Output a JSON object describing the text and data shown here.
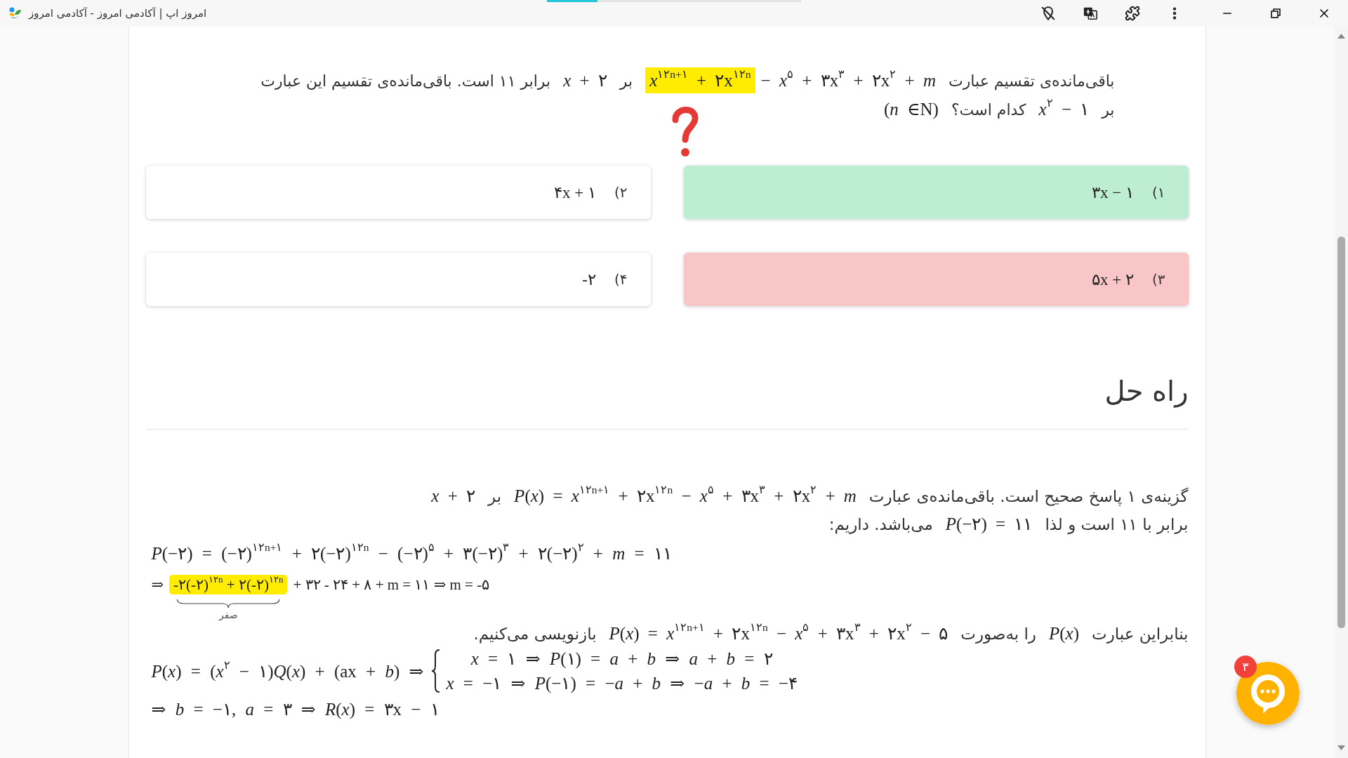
{
  "window": {
    "title": "امروز اپ | آکادمی امروز - آکادمی امروز",
    "loading_bar": {
      "level": 0.2
    }
  },
  "question": {
    "lines": [
      [
        {
          "kind": "text",
          "text": "باقی‌مانده‌ی تقسیم عبارت"
        },
        {
          "kind": "math",
          "highlighted_text": "*x*$^{۱۲n+۱}$ + ۲x$^{۱۲n}$",
          "text": "− *x*$^{۵}$ + ۳x$^{۳}$ + ۲x$^{۲}$ + *m*"
        },
        {
          "kind": "text",
          "text": "بر"
        },
        {
          "kind": "math",
          "text": "*x* + ۲"
        },
        {
          "kind": "text",
          "text": "برابر ۱۱ است. باقی‌مانده‌ی تقسیم این عبارت"
        }
      ],
      [
        {
          "kind": "text",
          "text": "بر"
        },
        {
          "kind": "math",
          "text": "*x*$^{۲}$ − ۱"
        },
        {
          "kind": "text",
          "text": "کدام است؟"
        },
        {
          "kind": "math",
          "text": "(*n* ∈N)"
        }
      ]
    ],
    "options": [
      {
        "number": "۱)",
        "value": "۳x − ۱",
        "correct": true,
        "selected": false
      },
      {
        "number": "۲)",
        "value": "۴x + ۱",
        "correct": false,
        "selected": false
      },
      {
        "number": "۳)",
        "value": "۵x + ۲",
        "correct": false,
        "selected": true
      },
      {
        "number": "۴)",
        "value": "-۲",
        "correct": false,
        "selected": false
      }
    ]
  },
  "solution": {
    "heading": "راه حل",
    "blocks": [
      {
        "kind": "paragraph",
        "lines": [
          [
            {
              "kind": "text",
              "text": "گزینه‌ی ۱ پاسخ صحیح است. باقی‌مانده‌ی عبارت"
            },
            {
              "kind": "math",
              "text": "*P*(*x*) = *x*$^{۱۲n+۱}$ + ۲x$^{۱۲n}$ − *x*$^{۵}$ + ۳x$^{۳}$ + ۲x$^{۲}$ + *m*"
            },
            {
              "kind": "text",
              "text": "بر"
            },
            {
              "kind": "math",
              "text": "*x* + ۲"
            }
          ],
          [
            {
              "kind": "text",
              "text": "برابر با ۱۱ است و لذا"
            },
            {
              "kind": "math",
              "text": "*P*(−۲) = ۱۱"
            },
            {
              "kind": "text",
              "text": "می‌باشد. داریم:"
            }
          ]
        ]
      },
      {
        "kind": "equation",
        "text": "*P*(−۲) = (−۲)$^{۱۲n+۱}$ + ۲(−۲)$^{۱۲n}$ − (−۲)$^{۵}$ + ۳(−۲)$^{۳}$ + ۲(−۲)$^{۲}$ + *m* = ۱۱"
      },
      {
        "kind": "equation",
        "lead": "⇒",
        "highlighted_text": "-۲(-۲)$^{۱۲n}$ + ۲(-۲)$^{۱۲n}$",
        "note": "صفر",
        "text": "+ ۳۲ - ۲۴ + ۸ + m = ۱۱ ⇒ m = -۵"
      },
      {
        "kind": "paragraph",
        "lines": [
          [
            {
              "kind": "text",
              "text": "بنابراین عبارت"
            },
            {
              "kind": "math",
              "text": "*P*(*x*)"
            },
            {
              "kind": "text",
              "text": "را به‌صورت"
            },
            {
              "kind": "math",
              "text": "*P*(*x*) = *x*$^{۱۲n+۱}$ + ۲x$^{۱۲n}$ − *x*$^{۵}$ + ۳x$^{۳}$ + ۲x$^{۲}$ − ۵"
            },
            {
              "kind": "text",
              "text": "بازنویسی می‌کنیم."
            }
          ]
        ]
      },
      {
        "kind": "system",
        "lhs": "*P*(*x*) = (*x*$^{۲}$ − ۱)*Q*(*x*) + (ax + *b*) ⇒",
        "cases": [
          "*x* = ۱ ⇒ *P*(۱) = *a* + *b* ⇒ *a* + *b* = ۲",
          "*x* = −۱ ⇒ *P*(−۱) = −*a* + *b* ⇒ −*a* + *b* = −۴"
        ]
      },
      {
        "kind": "equation",
        "text": "⇒ *b* = −۱, *a* = ۳ ⇒ *R*(*x*) = ۳x − ۱"
      }
    ]
  },
  "chat_button": {
    "badge": "۳"
  }
}
